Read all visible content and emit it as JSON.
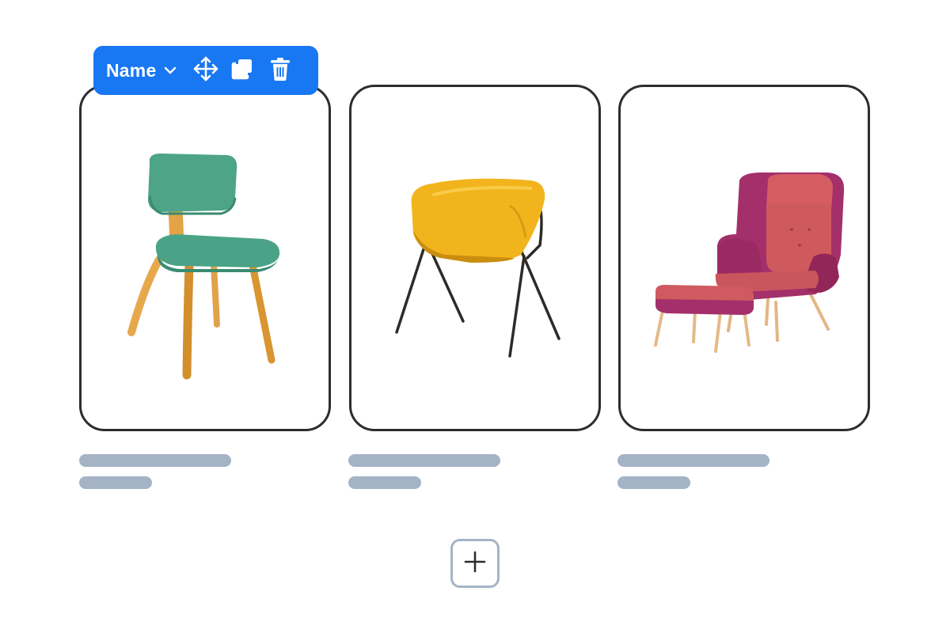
{
  "toolbar": {
    "name_label": "Name",
    "icons": {
      "dropdown": "chevron-down-icon",
      "move": "move-icon",
      "duplicate": "duplicate-icon",
      "delete": "trash-icon"
    },
    "accent_color": "#1877f2"
  },
  "products": [
    {
      "image": "green-upholstered-chair",
      "selected": true
    },
    {
      "image": "yellow-shell-chair",
      "selected": false
    },
    {
      "image": "magenta-wingback-armchair-with-ottoman",
      "selected": false
    }
  ],
  "placeholder_color": "#a5b3c7",
  "add_button": {
    "icon": "plus-icon"
  }
}
